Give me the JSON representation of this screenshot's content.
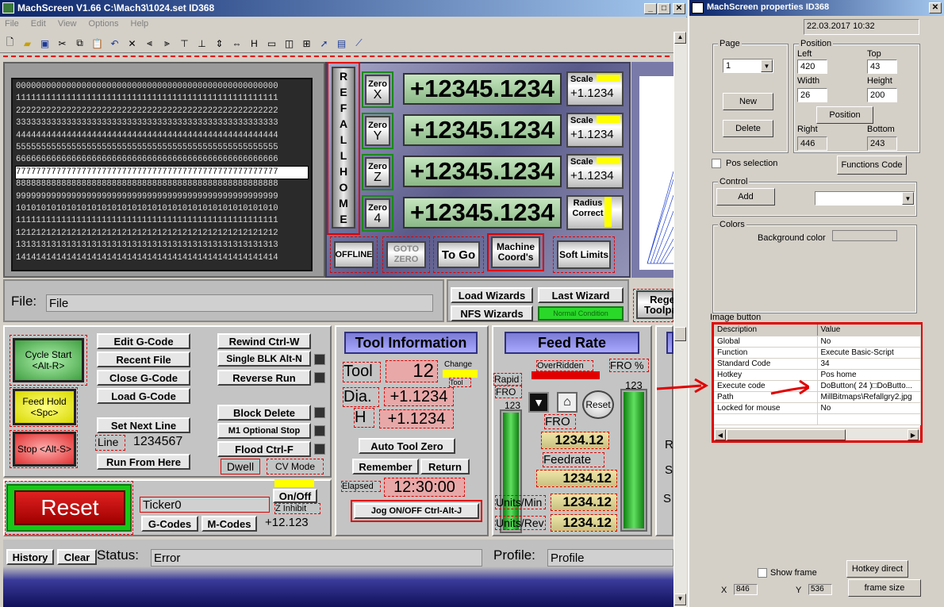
{
  "main": {
    "title": "MachScreen V1.66   C:\\Mach3\\1024.set   ID368",
    "menu": [
      "File",
      "Edit",
      "View",
      "Options",
      "Help"
    ],
    "gcode_lines": [
      "0000000000000000000000000000000000000000000000000000",
      "1111111111111111111111111111111111111111111111111111",
      "2222222222222222222222222222222222222222222222222222",
      "3333333333333333333333333333333333333333333333333333",
      "4444444444444444444444444444444444444444444444444444",
      "5555555555555555555555555555555555555555555555555555",
      "6666666666666666666666666666666666666666666666666666",
      "7777777777777777777777777777777777777777777777777777",
      "8888888888888888888888888888888888888888888888888888",
      "9999999999999999999999999999999999999999999999999999",
      "1010101010101010101010101010101010101010101010101010",
      "1111111111111111111111111111111111111111111111111111",
      "1212121212121212121212121212121212121212121212121212",
      "1313131313131313131313131313131313131313131313131313",
      "1414141414141414141414141414141414141414141414141414"
    ],
    "ref_all_home": [
      "R",
      "E",
      "F",
      "A",
      "L",
      "L",
      "H",
      "O",
      "M",
      "E"
    ],
    "axes": [
      {
        "zero_label": "Zero",
        "axis": "X",
        "dro": "+12345.1234",
        "side_label": "Scale",
        "side_value": "+1.1234"
      },
      {
        "zero_label": "Zero",
        "axis": "Y",
        "dro": "+12345.1234",
        "side_label": "Scale",
        "side_value": "+1.1234"
      },
      {
        "zero_label": "Zero",
        "axis": "Z",
        "dro": "+12345.1234",
        "side_label": "Scale",
        "side_value": "+1.1234"
      },
      {
        "zero_label": "Zero",
        "axis": "4",
        "dro": "+12345.1234",
        "side_label": "Radius Correct",
        "side_value": ""
      }
    ],
    "dro_buttons": {
      "offline": "OFFLINE",
      "goto_zero": "GOTO ZERO",
      "to_go": "To Go",
      "machine_coords": "Machine Coord's",
      "soft_limits": "Soft Limits"
    },
    "file": {
      "label": "File:",
      "value": "File"
    },
    "wizards": {
      "load": "Load Wizards",
      "last": "Last Wizard",
      "nfs": "NFS Wizards",
      "normal": "Normal Condition",
      "regen": "Regen Toolpath"
    },
    "left": {
      "cycle_start": "Cycle Start <Alt-R>",
      "feed_hold": "Feed Hold <Spc>",
      "stop": "Stop <Alt-S>",
      "edit": "Edit G-Code",
      "recent": "Recent File",
      "close": "Close G-Code",
      "load": "Load G-Code",
      "set_next": "Set Next Line",
      "line_label": "Line",
      "line_value": "1234567",
      "run_from": "Run From Here",
      "rewind": "Rewind Ctrl-W",
      "single_blk": "Single BLK Alt-N",
      "reverse": "Reverse Run",
      "block_delete": "Block Delete",
      "m1": "M1 Optional Stop",
      "flood": "Flood Ctrl-F",
      "dwell": "Dwell",
      "cv_mode": "CV Mode",
      "reset": "Reset",
      "ticker": "Ticker0",
      "on_off": "On/Off",
      "z_inhibit": "Z Inhibit",
      "gcodes": "G-Codes",
      "mcodes": "M-Codes",
      "z_value": "+12.123"
    },
    "tool": {
      "title": "Tool Information",
      "tool_label": "Tool",
      "tool_value": "12",
      "change": "Change",
      "tool_small": "Tool",
      "dia_label": "Dia.",
      "dia_value": "+1.1234",
      "h_label": "H",
      "h_value": "+1.1234",
      "auto_zero": "Auto Tool Zero",
      "remember": "Remember",
      "return": "Return",
      "elapsed_label": "Elapsed",
      "elapsed_value": "12:30:00",
      "jog": "Jog ON/OFF Ctrl-Alt-J"
    },
    "feed": {
      "title": "Feed Rate",
      "overridden": "OverRidden",
      "fro_pct": "FRO %",
      "rapid": "Rapid",
      "fro": "FRO",
      "rapid_value": "123",
      "fro_value": "123",
      "reset": "Reset",
      "fro_label": "FRO",
      "fro_num": "1234.12",
      "feedrate_label": "Feedrate",
      "feedrate_num": "1234.12",
      "units_min_label": "Units/Min",
      "units_min": "1234.12",
      "units_rev_label": "Units/Rev",
      "units_rev": "1234.12"
    },
    "partial_right": [
      "R",
      "S",
      "S"
    ],
    "status": {
      "history": "History",
      "clear": "Clear",
      "status_label": "Status:",
      "status_value": "Error",
      "profile_label": "Profile:",
      "profile_value": "Profile"
    }
  },
  "props": {
    "title": "MachScreen properties  ID368",
    "datetime": "22.03.2017  10:32",
    "page_label": "Page",
    "page_value": "1",
    "new": "New",
    "delete": "Delete",
    "position_label": "Position",
    "left_label": "Left",
    "left": "420",
    "top_label": "Top",
    "top": "43",
    "width_label": "Width",
    "width": "26",
    "height_label": "Height",
    "height": "200",
    "position_btn": "Position",
    "right_label": "Right",
    "right": "446",
    "bottom_label": "Bottom",
    "bottom": "243",
    "pos_selection": "Pos selection",
    "functions_code": "Functions Code",
    "control_label": "Control",
    "add": "Add",
    "colors_label": "Colors",
    "bg_color": "Background color",
    "image_button": "Image button",
    "table_headers": [
      "Description",
      "Value"
    ],
    "rows": [
      [
        "Global",
        "No"
      ],
      [
        "Function",
        "Execute Basic-Script"
      ],
      [
        "Standard Code",
        "34"
      ],
      [
        "Hotkey",
        "Pos home"
      ],
      [
        "Execute code",
        "DoButton( 24 )□DoButto..."
      ],
      [
        "Path",
        "MillBitmaps\\Refallgry2.jpg"
      ],
      [
        "Locked for mouse",
        "No"
      ]
    ],
    "show_frame": "Show frame",
    "hotkey_direct": "Hotkey direct",
    "frame_size": "frame size",
    "x_label": "X",
    "x_value": "846",
    "y_label": "Y",
    "y_value": "536"
  }
}
